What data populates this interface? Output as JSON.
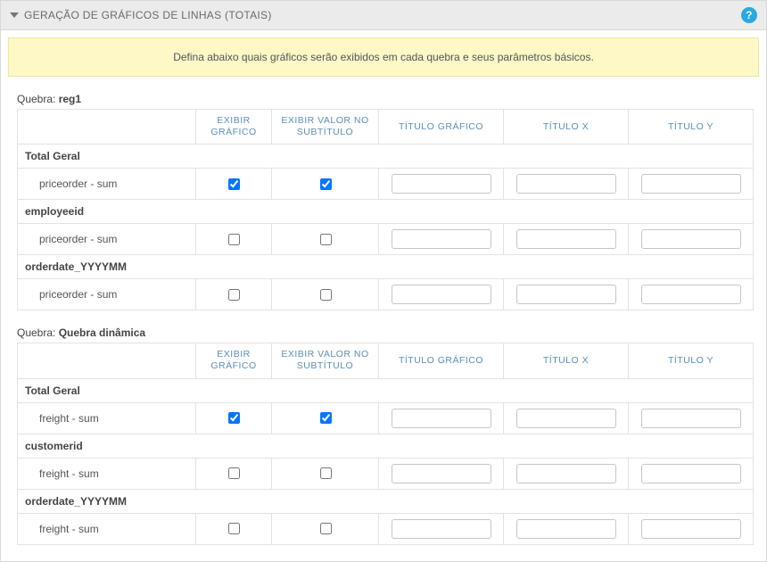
{
  "header": {
    "title": "GERAÇÃO DE GRÁFICOS DE LINHAS (TOTAIS)",
    "help_symbol": "?"
  },
  "banner": "Defina abaixo quais gráficos serão exibidos em cada quebra e seus parâmetros básicos.",
  "quebra_label": "Quebra:",
  "columns": {
    "exibir_grafico": "EXIBIR GRÁFICO",
    "exibir_valor": "EXIBIR VALOR NO SUBTÍTULO",
    "titulo_grafico": "TÍTULO GRÁFICO",
    "titulo_x": "TÍTULO X",
    "titulo_y": "TÍTULO Y"
  },
  "groups": [
    {
      "name": "reg1",
      "sections": [
        {
          "title": "Total Geral",
          "rows": [
            {
              "field": "priceorder - sum",
              "show_chart": true,
              "show_subtitle": true,
              "t_chart": "",
              "t_x": "",
              "t_y": ""
            }
          ]
        },
        {
          "title": "employeeid",
          "rows": [
            {
              "field": "priceorder - sum",
              "show_chart": false,
              "show_subtitle": false,
              "t_chart": "",
              "t_x": "",
              "t_y": ""
            }
          ]
        },
        {
          "title": "orderdate_YYYYMM",
          "rows": [
            {
              "field": "priceorder - sum",
              "show_chart": false,
              "show_subtitle": false,
              "t_chart": "",
              "t_x": "",
              "t_y": ""
            }
          ]
        }
      ]
    },
    {
      "name": "Quebra dinâmica",
      "sections": [
        {
          "title": "Total Geral",
          "rows": [
            {
              "field": "freight - sum",
              "show_chart": true,
              "show_subtitle": true,
              "t_chart": "",
              "t_x": "",
              "t_y": ""
            }
          ]
        },
        {
          "title": "customerid",
          "rows": [
            {
              "field": "freight - sum",
              "show_chart": false,
              "show_subtitle": false,
              "t_chart": "",
              "t_x": "",
              "t_y": ""
            }
          ]
        },
        {
          "title": "orderdate_YYYYMM",
          "rows": [
            {
              "field": "freight - sum",
              "show_chart": false,
              "show_subtitle": false,
              "t_chart": "",
              "t_x": "",
              "t_y": ""
            }
          ]
        }
      ]
    }
  ]
}
